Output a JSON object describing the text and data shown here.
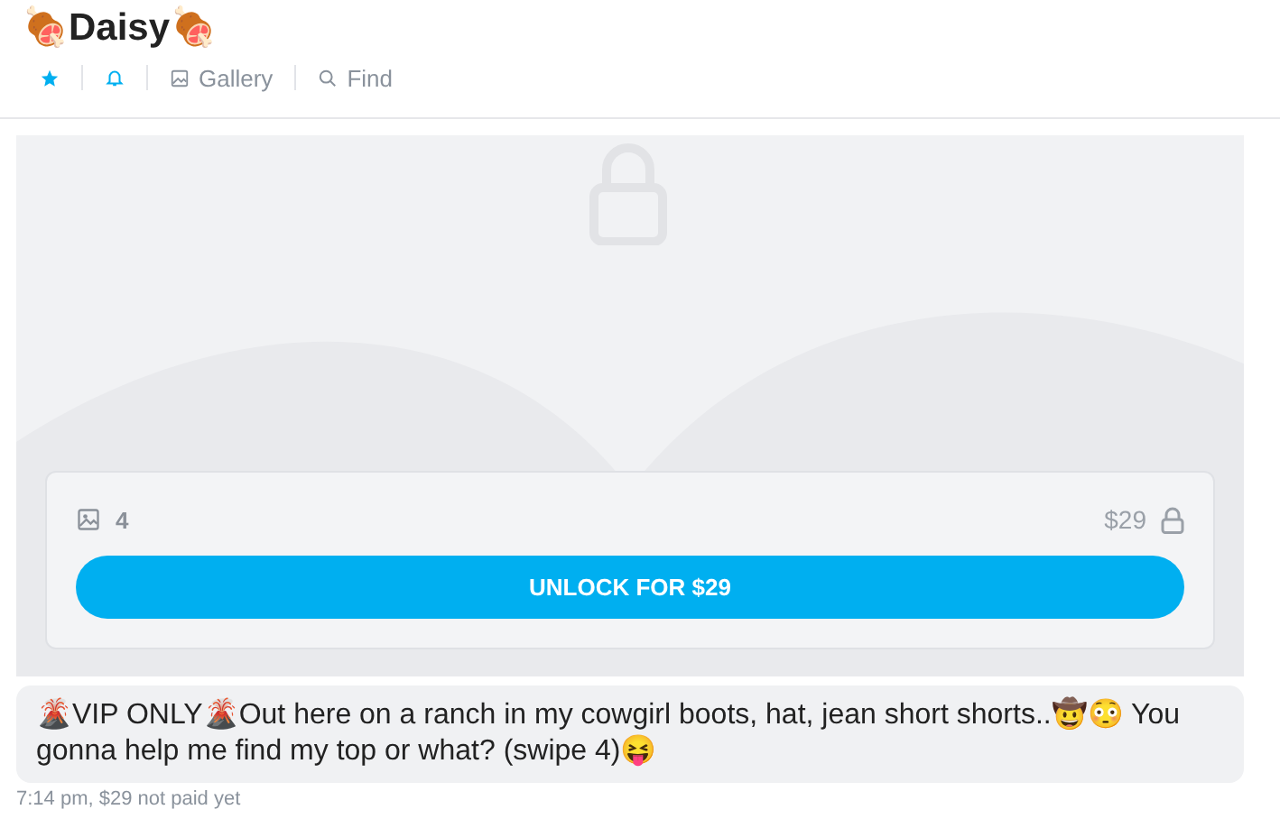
{
  "header": {
    "title": "🍖Daisy🍖"
  },
  "tabs": [
    {
      "kind": "star",
      "selected": true
    },
    {
      "kind": "bell",
      "selected": true
    },
    {
      "kind": "gallery",
      "label": "Gallery",
      "selected": false
    },
    {
      "kind": "find",
      "label": "Find",
      "selected": false
    }
  ],
  "locked_post": {
    "media_count": "4",
    "price": "$29",
    "button": "UNLOCK FOR $29"
  },
  "message": {
    "text": "🌋VIP ONLY🌋Out here on a ranch in my cowgirl boots, hat, jean short shorts..🤠😳 You gonna help me find my top or what? (swipe 4)😝",
    "meta": "7:14 pm, $29 not paid yet"
  }
}
